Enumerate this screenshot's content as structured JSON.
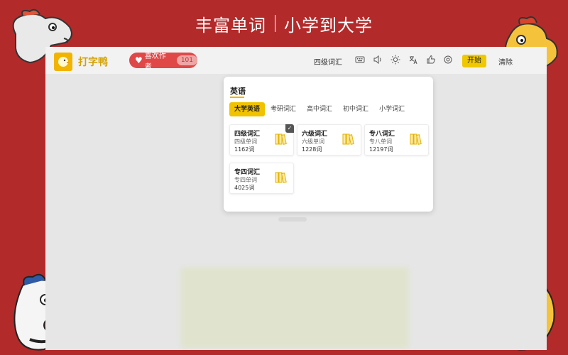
{
  "banner": {
    "left": "丰富单词",
    "right": "小学到大学"
  },
  "app": {
    "name": "打字鸭",
    "like_label": "喜欢作者",
    "like_count": "101"
  },
  "topbar": {
    "dict": "四级词汇",
    "start": "开始",
    "clear": "清除"
  },
  "dictionary": {
    "language": "英语",
    "tabs": [
      "大学英语",
      "考研词汇",
      "高中词汇",
      "初中词汇",
      "小学词汇"
    ],
    "active_tab": 0,
    "cards": [
      {
        "name": "四级词汇",
        "sub": "四级单词",
        "count": "1162词",
        "selected": true
      },
      {
        "name": "六级词汇",
        "sub": "六级单词",
        "count": "1228词",
        "selected": false
      },
      {
        "name": "专八词汇",
        "sub": "专八单词",
        "count": "12197词",
        "selected": false
      },
      {
        "name": "专四词汇",
        "sub": "专四单词",
        "count": "4025词",
        "selected": false
      }
    ]
  },
  "colors": {
    "frame_red": "#b32a2a",
    "accent_yellow": "#f1c200",
    "like_red": "#e04848"
  }
}
